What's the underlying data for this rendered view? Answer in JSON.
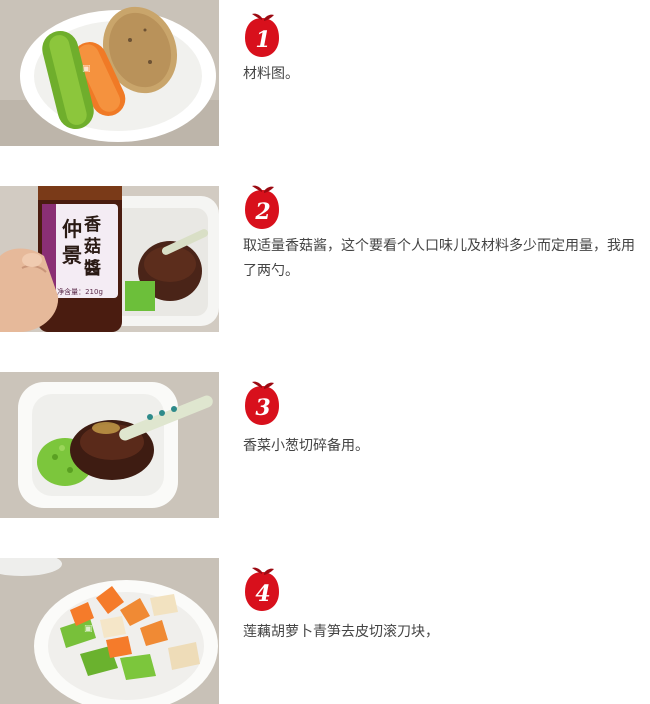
{
  "steps": [
    {
      "number": "1",
      "text": "材料图。",
      "photo_desc": "lotus root, carrot and green pepper on a white plate"
    },
    {
      "number": "2",
      "text": "取适量香菇酱，这个要看个人口味儿及材料多少而定用量，我用了两勺。",
      "jar_label": "仲景香菇酱",
      "jar_weight": "净含量：210g"
    },
    {
      "number": "3",
      "text": "香菜小葱切碎备用。"
    },
    {
      "number": "4",
      "text": "莲藕胡萝卜青笋去皮切滚刀块，"
    }
  ],
  "colors": {
    "badge_red": "#d8101c",
    "badge_dark": "#9c0a12",
    "plate": "#f7f7f5",
    "table": "#c9c2b8"
  }
}
